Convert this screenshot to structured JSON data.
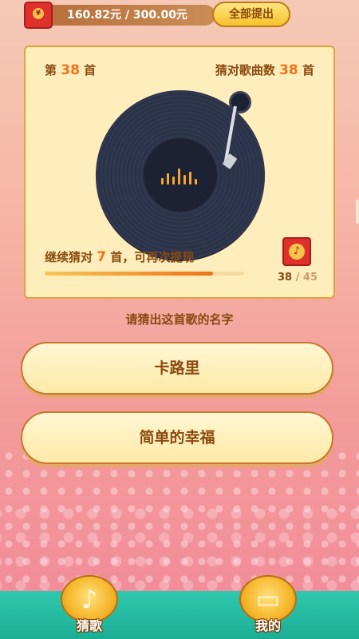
{
  "topbar": {
    "balance": "160.82元",
    "separator": "/",
    "target": "300.00元",
    "withdraw_label": "全部提出",
    "coin_symbol": "¥"
  },
  "card": {
    "song_prefix": "第",
    "song_number": "38",
    "song_suffix": "首",
    "correct_label": "猜对歌曲数",
    "correct_count": "38",
    "hint_prefix": "继续猜对",
    "hint_number": "7",
    "hint_suffix": "首，可再次提现",
    "progress_current": "38",
    "progress_total": "/ 45",
    "progress_fraction": 0.844
  },
  "question": "请猜出这首歌的名字",
  "answers": [
    {
      "label": "卡路里"
    },
    {
      "label": "简单的幸福"
    }
  ],
  "nav": {
    "guess_label": "猜歌",
    "mine_label": "我的",
    "guess_icon": "music-note-icon",
    "mine_icon": "wallet-icon"
  },
  "colors": {
    "accent": "#f0731a",
    "card_bg": "#ffeebc",
    "nav_bg": "#1cae95"
  }
}
